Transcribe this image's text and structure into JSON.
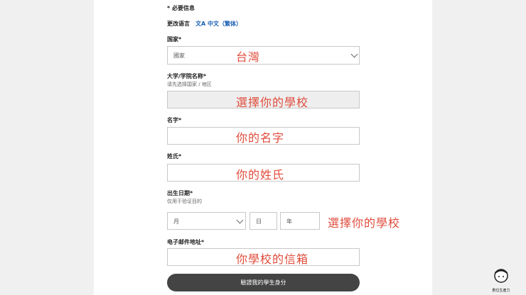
{
  "required_note": "* 必要信息",
  "language": {
    "label": "更改语言",
    "current": "文A 中文（繁体）"
  },
  "country": {
    "label": "国家*",
    "placeholder": "國家",
    "annotation": "台灣"
  },
  "school": {
    "label": "大学/学院名称*",
    "hint": "请先选择国家 / 地区",
    "annotation": "選擇你的學校"
  },
  "first_name": {
    "label": "名字*",
    "annotation": "你的名字"
  },
  "last_name": {
    "label": "姓氏*",
    "annotation": "你的姓氏"
  },
  "birthdate": {
    "label": "出生日期*",
    "hint": "仅用于验证目的",
    "month_placeholder": "月",
    "day_placeholder": "日",
    "year_placeholder": "年",
    "annotation": "選擇你的學校"
  },
  "email": {
    "label": "电子邮件地址*",
    "annotation": "你學校的信箱"
  },
  "submit_label": "驗證我的學生身分",
  "brand": {
    "name": "數位生產力"
  }
}
